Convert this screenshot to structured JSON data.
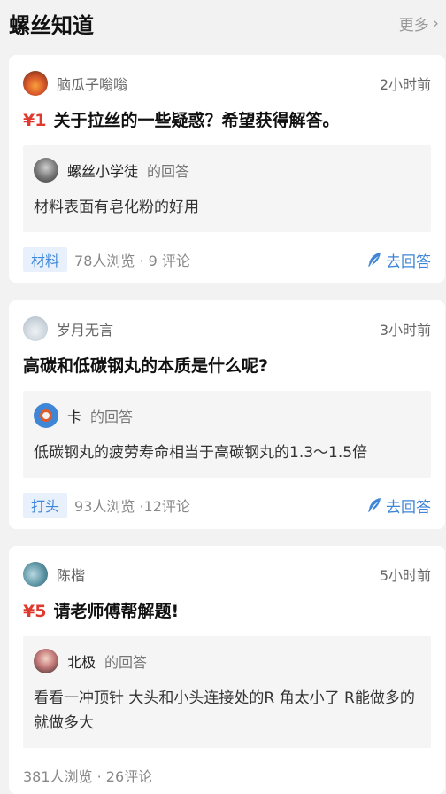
{
  "header": {
    "title": "螺丝知道",
    "more_label": "更多"
  },
  "cards": [
    {
      "author": "脑瓜子嗡嗡",
      "time": "2小时前",
      "bounty": "¥1",
      "question": "关于拉丝的一些疑惑？希望获得解答。",
      "answerer": "螺丝小学徒",
      "answered_suffix": "的回答",
      "answer": "材料表面有皂化粉的好用",
      "tag": "材料",
      "stats": "78人浏览 · 9 评论",
      "reply_label": "去回答"
    },
    {
      "author": "岁月无言",
      "time": "3小时前",
      "bounty": "",
      "question": "高碳和低碳钢丸的本质是什么呢?",
      "answerer": "卡",
      "answered_suffix": "的回答",
      "answer": "低碳钢丸的疲劳寿命相当于高碳钢丸的1.3～1.5倍",
      "tag": "打头",
      "stats": "93人浏览 ·12评论",
      "reply_label": "去回答"
    },
    {
      "author": "陈楷",
      "time": "5小时前",
      "bounty": "¥5",
      "question": "请老师傅帮解题!",
      "answerer": "北极",
      "answered_suffix": "的回答",
      "answer": "看看一冲顶针 大头和小头连接处的R 角太小了 R能做多的就做多大",
      "tag": "",
      "stats": "381人浏览 · 26评论",
      "reply_label": ""
    }
  ],
  "colors": {
    "accent": "#3f86d6",
    "bounty": "#e03a2f",
    "background": "#f2f2f2"
  }
}
